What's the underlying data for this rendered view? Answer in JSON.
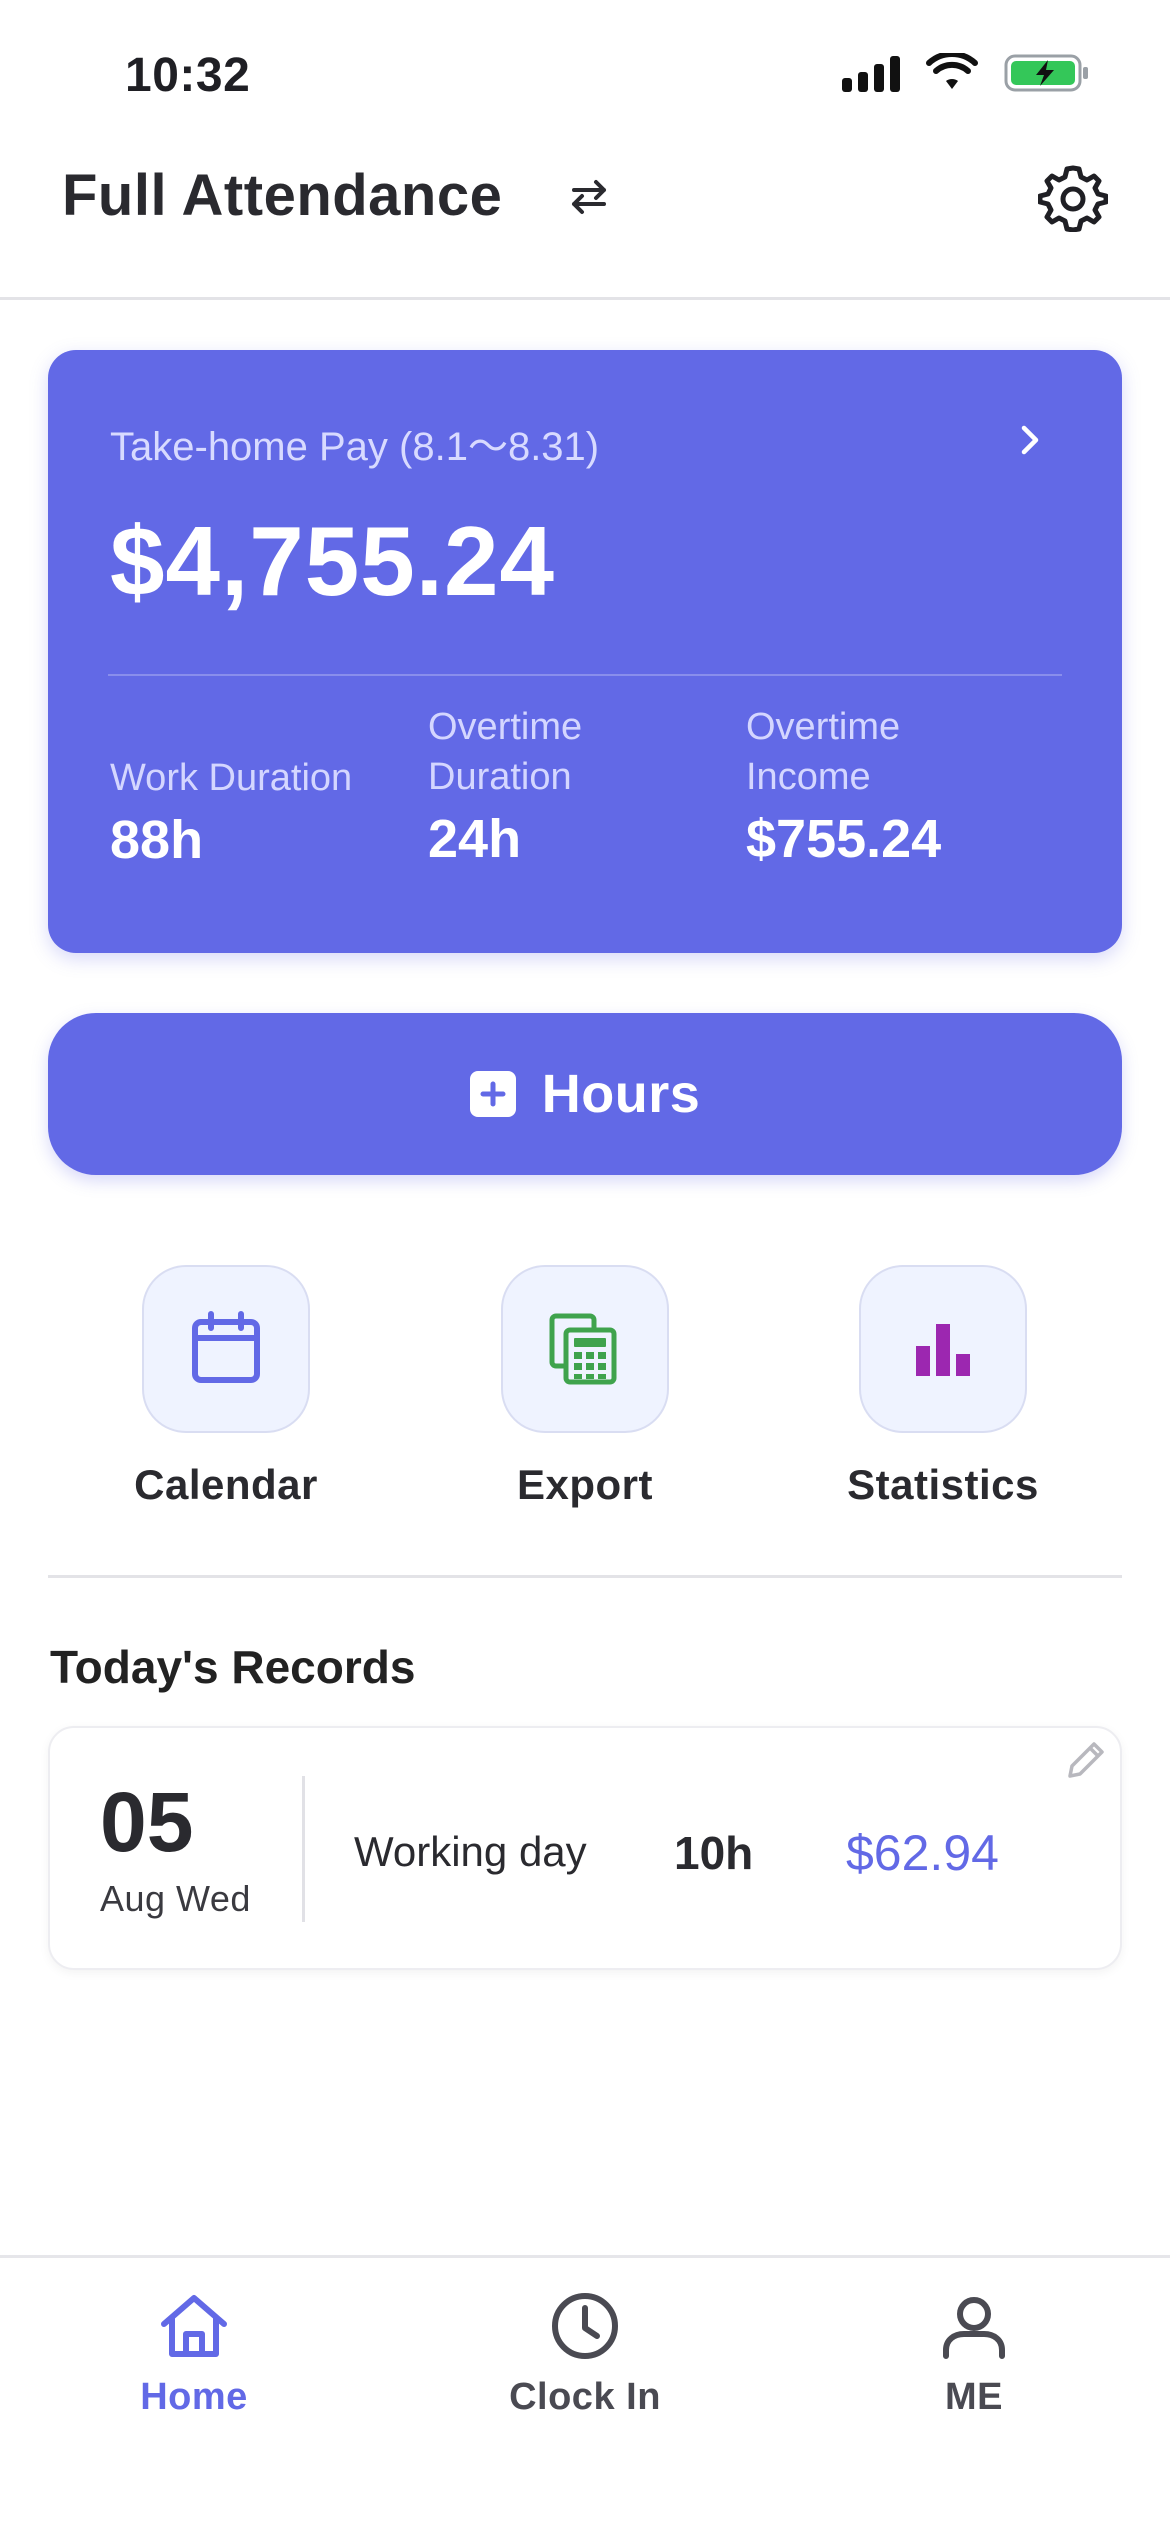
{
  "status_bar": {
    "time": "10:32"
  },
  "header": {
    "title": "Full Attendance"
  },
  "pay_card": {
    "label": "Take-home Pay (8.1～8.31)",
    "amount": "$4,755.24",
    "stats": [
      {
        "label": "Work Duration",
        "value": "88h"
      },
      {
        "label": "Overtime Duration",
        "value": "24h"
      },
      {
        "label": "Overtime Income",
        "value": "$755.24"
      }
    ]
  },
  "hours_button": {
    "label": "Hours"
  },
  "quick_actions": [
    {
      "label": "Calendar",
      "icon": "calendar-icon"
    },
    {
      "label": "Export",
      "icon": "spreadsheet-icon"
    },
    {
      "label": "Statistics",
      "icon": "bar-chart-icon"
    }
  ],
  "records": {
    "title": "Today's Records",
    "items": [
      {
        "day": "05",
        "date": "Aug Wed",
        "type": "Working day",
        "hours": "10h",
        "pay": "$62.94"
      }
    ]
  },
  "bottom_nav": [
    {
      "label": "Home",
      "icon": "home-icon",
      "active": true
    },
    {
      "label": "Clock In",
      "icon": "clock-icon",
      "active": false
    },
    {
      "label": "ME",
      "icon": "person-icon",
      "active": false
    }
  ],
  "colors": {
    "accent": "#6269E6",
    "export_icon": "#3FA34D",
    "stats_icon": "#9C27B0"
  }
}
